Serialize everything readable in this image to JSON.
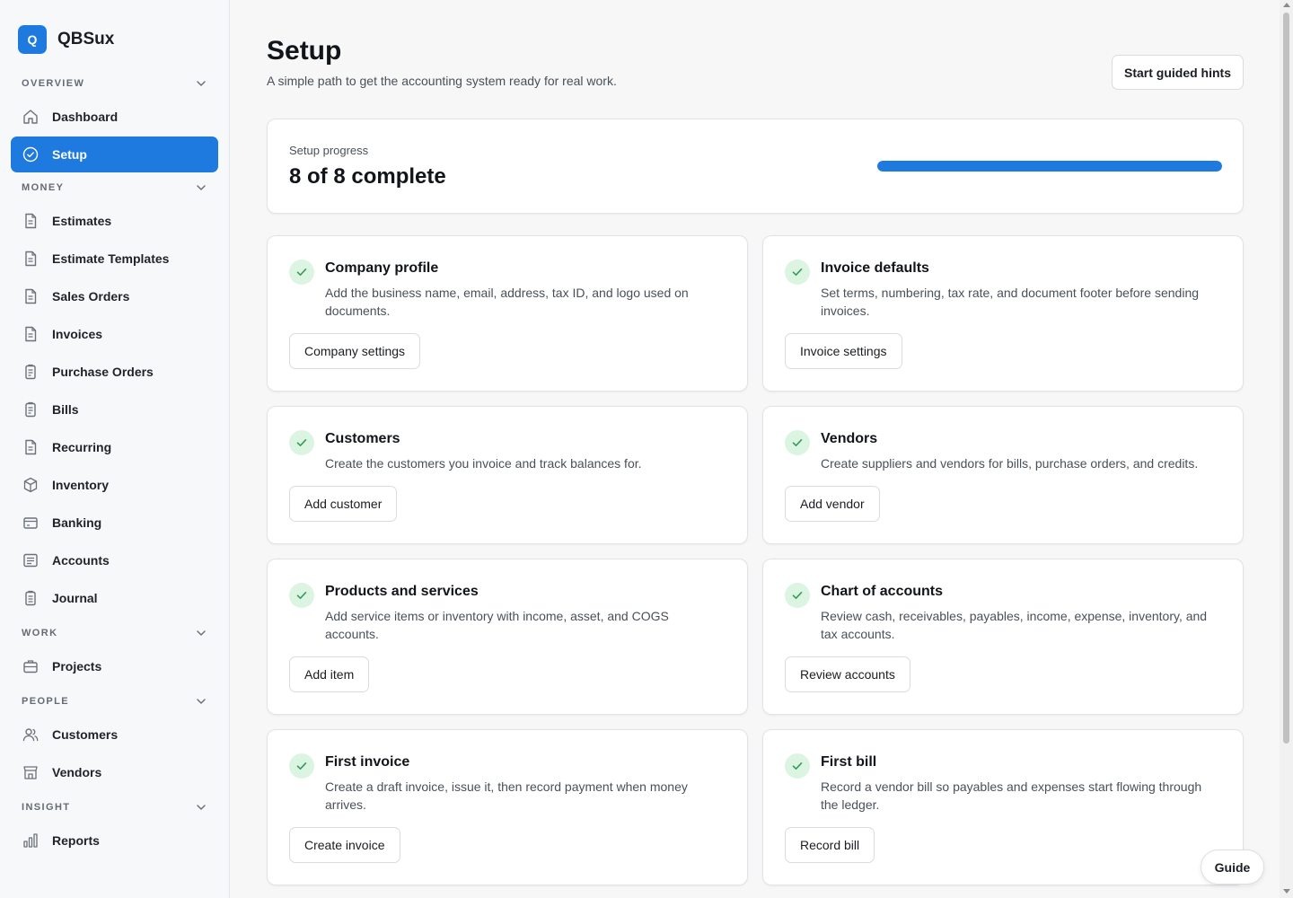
{
  "brand": {
    "logo_letter": "Q",
    "name": "QBSux"
  },
  "sidebar": {
    "sections": {
      "overview": "OVERVIEW",
      "money": "MONEY",
      "work": "WORK",
      "people": "PEOPLE",
      "insight": "INSIGHT"
    },
    "items": {
      "dashboard": "Dashboard",
      "setup": "Setup",
      "estimates": "Estimates",
      "estimate_templates": "Estimate Templates",
      "sales_orders": "Sales Orders",
      "invoices": "Invoices",
      "purchase_orders": "Purchase Orders",
      "bills": "Bills",
      "recurring": "Recurring",
      "inventory": "Inventory",
      "banking": "Banking",
      "accounts": "Accounts",
      "journal": "Journal",
      "projects": "Projects",
      "customers": "Customers",
      "vendors": "Vendors",
      "reports": "Reports"
    },
    "active": "Setup"
  },
  "header": {
    "title": "Setup",
    "subtitle": "A simple path to get the accounting system ready for real work.",
    "hint_button": "Start guided hints"
  },
  "progress": {
    "label": "Setup progress",
    "value_text": "8 of 8 complete",
    "completed": 8,
    "total": 8
  },
  "tasks": [
    {
      "title": "Company profile",
      "description": "Add the business name, email, address, tax ID, and logo used on documents.",
      "button": "Company settings",
      "done": true
    },
    {
      "title": "Invoice defaults",
      "description": "Set terms, numbering, tax rate, and document footer before sending invoices.",
      "button": "Invoice settings",
      "done": true
    },
    {
      "title": "Customers",
      "description": "Create the customers you invoice and track balances for.",
      "button": "Add customer",
      "done": true
    },
    {
      "title": "Vendors",
      "description": "Create suppliers and vendors for bills, purchase orders, and credits.",
      "button": "Add vendor",
      "done": true
    },
    {
      "title": "Products and services",
      "description": "Add service items or inventory with income, asset, and COGS accounts.",
      "button": "Add item",
      "done": true
    },
    {
      "title": "Chart of accounts",
      "description": "Review cash, receivables, payables, income, expense, inventory, and tax accounts.",
      "button": "Review accounts",
      "done": true
    },
    {
      "title": "First invoice",
      "description": "Create a draft invoice, issue it, then record payment when money arrives.",
      "button": "Create invoice",
      "done": true
    },
    {
      "title": "First bill",
      "description": "Record a vendor bill so payables and expenses start flowing through the ledger.",
      "button": "Record bill",
      "done": true
    }
  ],
  "guide_button": "Guide",
  "colors": {
    "accent": "#1f7ae0",
    "check_bg": "#dcf5e3",
    "check_mark": "#3a9a5b"
  },
  "icons": {
    "dashboard": "home-icon",
    "setup": "check-circle-icon",
    "estimates": "document-icon",
    "purchase_orders": "clipboard-icon",
    "inventory": "box-icon",
    "banking": "bank-card-icon",
    "accounts": "ledger-icon",
    "journal": "journal-icon",
    "projects": "briefcase-icon",
    "customers": "users-icon",
    "vendors": "store-icon",
    "reports": "bar-chart-icon"
  }
}
